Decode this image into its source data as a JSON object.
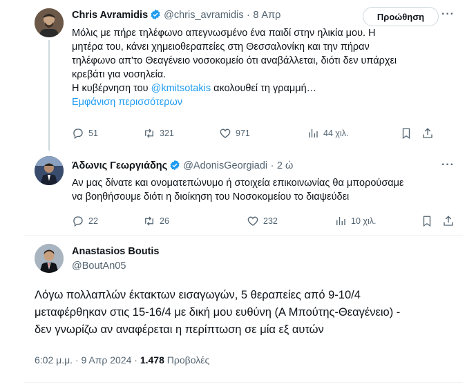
{
  "tweet1": {
    "name": "Chris Avramidis",
    "handle": "@chris_avramidis",
    "sep": "·",
    "time": "8 Απρ",
    "promote": "Προώθηση",
    "more": "···",
    "lines": [
      "Μόλις με πήρε τηλέφωνο απεγνωσμένο ένα παιδί στην ηλικία μου. Η",
      "μητέρα του, κάνει χημειοθεραπείες στη Θεσσαλονίκη και την πήραν",
      "τηλέφωνο απ'το Θεαγένειο νοσοκομείο ότι αναβάλλεται, διότι δεν υπάρχει",
      "κρεβάτι για νοσηλεία."
    ],
    "line5_pre": "Η κυβέρνηση του ",
    "line5_mention": "@kmitsotakis",
    "line5_post": " ακολουθεί τη γραμμή…",
    "show_more": "Εμφάνιση περισσότερων",
    "replies": "51",
    "retweets": "321",
    "likes": "971",
    "views": "44 χιλ."
  },
  "tweet2": {
    "name": "Άδωνις Γεωργιάδης",
    "handle": "@AdonisGeorgiadi",
    "sep": "·",
    "time": "2 ώ",
    "more": "···",
    "lines": [
      "Αν μας δίνατε και ονοματεπώνυμο ή στοιχεία επικοινωνίας θα μπορούσαμε",
      "να βοηθήσουμε διότι η διοίκηση του Νοσοκομείου το διαψεύδει"
    ],
    "replies": "22",
    "retweets": "26",
    "likes": "232",
    "views": "10 χιλ."
  },
  "tweet3": {
    "name": "Anastasios Boutis",
    "handle": "@BoutAn05",
    "more": "···",
    "lines": [
      "Λόγω πολλαπλών έκτακτων εισαγωγών, 5 θεραπείες από 9-10/4",
      "μεταφέρθηκαν στις 15-16/4 με δική μου ευθύνη (Α Μπούτης-Θεαγένειο) -",
      "δεν γνωρίζω αν αναφέρεται η περίπτωση σε μία εξ αυτών"
    ],
    "time": "6:02 μ.μ. · 9 Απρ 2024 ·",
    "views_count": "1.478",
    "views_label": "Προβολές"
  },
  "colors": {
    "accent": "#1d9bf0",
    "muted": "#536471",
    "text": "#0f1419"
  },
  "icons": [
    "verified-badge-icon",
    "reply-icon",
    "retweet-icon",
    "like-icon",
    "views-icon",
    "bookmark-icon",
    "share-icon",
    "more-icon"
  ]
}
